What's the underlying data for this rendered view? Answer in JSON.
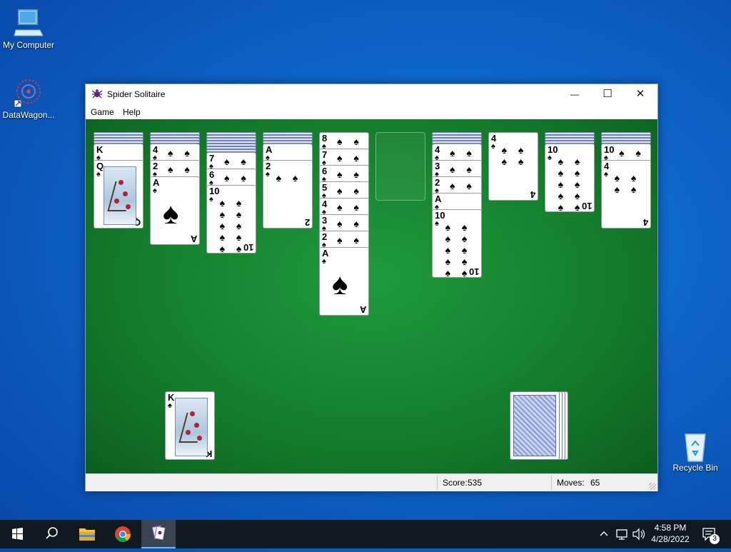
{
  "desktop": {
    "icons": [
      {
        "label": "My Computer"
      },
      {
        "label": "DataWagon..."
      },
      {
        "label": "Recycle Bin"
      }
    ]
  },
  "window": {
    "title": "Spider Solitaire",
    "menu": [
      "Game",
      "Help"
    ],
    "controls": {
      "minimize": "—",
      "maximize": "☐",
      "close": "✕"
    }
  },
  "game": {
    "tableau": [
      {
        "hidden": 4,
        "cards": [
          {
            "rank": "K",
            "suit": "♠"
          },
          {
            "rank": "Q",
            "suit": "♠"
          }
        ]
      },
      {
        "hidden": 4,
        "cards": [
          {
            "rank": "4",
            "suit": "♠"
          },
          {
            "rank": "2",
            "suit": "♠"
          },
          {
            "rank": "A",
            "suit": "♠"
          }
        ]
      },
      {
        "hidden": 7,
        "cards": [
          {
            "rank": "7",
            "suit": "♠"
          },
          {
            "rank": "6",
            "suit": "♠"
          },
          {
            "rank": "10",
            "suit": "♠"
          }
        ]
      },
      {
        "hidden": 4,
        "cards": [
          {
            "rank": "A",
            "suit": "♠"
          },
          {
            "rank": "2",
            "suit": "♠"
          }
        ]
      },
      {
        "hidden": 0,
        "cards": [
          {
            "rank": "8",
            "suit": "♠"
          },
          {
            "rank": "7",
            "suit": "♠"
          },
          {
            "rank": "6",
            "suit": "♠"
          },
          {
            "rank": "5",
            "suit": "♠"
          },
          {
            "rank": "4",
            "suit": "♠"
          },
          {
            "rank": "3",
            "suit": "♠"
          },
          {
            "rank": "2",
            "suit": "♠"
          },
          {
            "rank": "A",
            "suit": "♠"
          }
        ]
      },
      {
        "hidden": 0,
        "cards": []
      },
      {
        "hidden": 4,
        "cards": [
          {
            "rank": "4",
            "suit": "♠"
          },
          {
            "rank": "3",
            "suit": "♠"
          },
          {
            "rank": "2",
            "suit": "♠"
          },
          {
            "rank": "A",
            "suit": "♠"
          },
          {
            "rank": "10",
            "suit": "♠"
          }
        ]
      },
      {
        "hidden": 0,
        "cards": [
          {
            "rank": "4",
            "suit": "♠"
          }
        ]
      },
      {
        "hidden": 4,
        "cards": [
          {
            "rank": "10",
            "suit": "♠"
          }
        ]
      },
      {
        "hidden": 4,
        "cards": [
          {
            "rank": "10",
            "suit": "♠"
          },
          {
            "rank": "4",
            "suit": "♠"
          }
        ]
      }
    ],
    "completed_top": {
      "rank": "K",
      "suit": "♠"
    },
    "stock_piles": 4
  },
  "status": {
    "score_label": "Score:",
    "score": "535",
    "moves_label": "Moves:",
    "moves": "65"
  },
  "taskbar": {
    "clock_time": "4:58 PM",
    "clock_date": "4/28/2022",
    "notification_count": "3"
  }
}
